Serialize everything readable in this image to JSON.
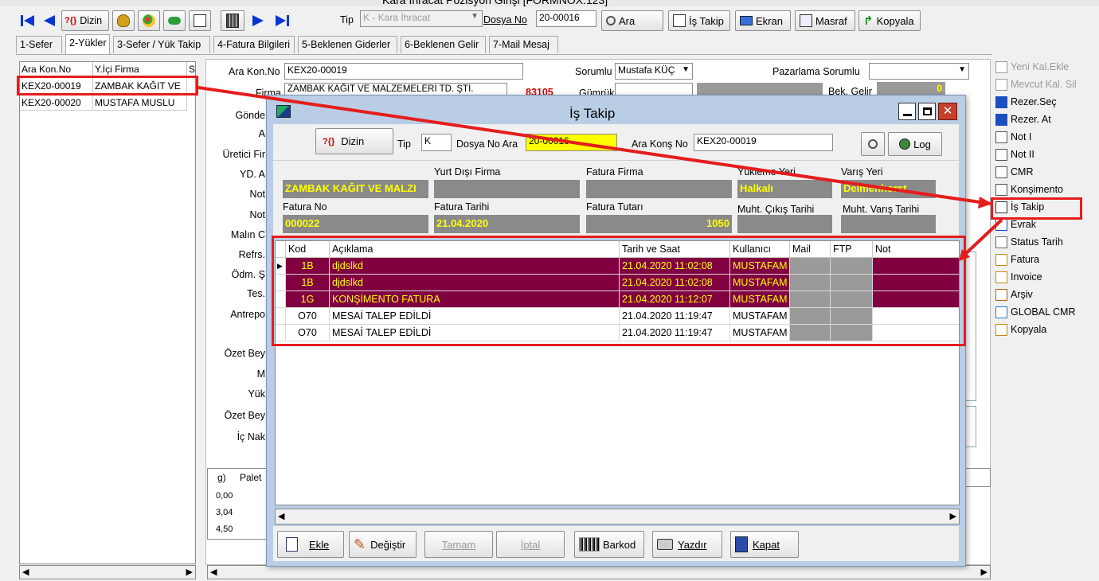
{
  "window": {
    "title": "Kara İhracat Pozisyon Girişi [FORMNOX:123]"
  },
  "toolbar": {
    "dizin": "Dizin",
    "tip_label": "Tip",
    "tip_value": "K - Kara İhracat",
    "dosya_label": "Dosya No",
    "dosya_value": "20-00016",
    "ara": "Ara",
    "is_takip": "İş Takip",
    "ekran": "Ekran",
    "masraf": "Masraf",
    "kopyala": "Kopyala"
  },
  "tabs": [
    "1-Sefer",
    "2-Yükler",
    "3-Sefer / Yük Takip",
    "4-Fatura Bilgileri",
    "5-Beklenen Giderler",
    "6-Beklenen Gelir",
    "7-Mail Mesaj"
  ],
  "left_list": {
    "headers": [
      "Ara Kon.No",
      "Y.İçi Firma",
      "S"
    ],
    "rows": [
      [
        "KEX20-00019",
        "ZAMBAK KAĞIT VE"
      ],
      [
        "KEX20-00020",
        "MUSTAFA MUSLU"
      ]
    ]
  },
  "form": {
    "ara_kon_label": "Ara Kon.No",
    "ara_kon_value": "KEX20-00019",
    "firma_label": "Firma",
    "firma_value": "ZAMBAK KAĞIT VE MALZEMELERİ TD. ŞTİ.",
    "firma_code": "83105",
    "sorumlu_label": "Sorumlu",
    "sorumlu_value": "Mustafa KÜÇ",
    "pazarlama_label": "Pazarlama Sorumlu",
    "gumruk_label": "Gümrük",
    "bek_gelir_label": "Bek. Gelir",
    "bek_gelir_value": "0",
    "side_labels": [
      "Gönde",
      "A",
      "Üretici Fir",
      "YD. A",
      "Not",
      "Not",
      "Malın C",
      "Refrs.",
      "Ödm. Ş",
      "Tes.",
      "Antrepo",
      "Özet Bey",
      "M",
      "Yük",
      "Özet Bey",
      "İç Nak"
    ],
    "bottom_header": [
      "g)",
      "Palet"
    ],
    "bottom_rows": [
      "0,00",
      "3,04",
      "4,50"
    ]
  },
  "right_menu": [
    {
      "label": "Yeni Kal.Ekle",
      "icon": "add-row-icon",
      "enabled": false
    },
    {
      "label": "Mevcut Kal. Sil",
      "icon": "delete-row-icon",
      "enabled": false
    },
    {
      "label": "Rezer.Seç",
      "icon": "rewind-icon",
      "enabled": true
    },
    {
      "label": "Rezer. At",
      "icon": "forward-icon",
      "enabled": true
    },
    {
      "label": "Not I",
      "icon": "note-icon",
      "enabled": true
    },
    {
      "label": "Not II",
      "icon": "note-icon",
      "enabled": true
    },
    {
      "label": "CMR",
      "icon": "document-icon",
      "enabled": true
    },
    {
      "label": "Konşimento",
      "icon": "document-icon",
      "enabled": true
    },
    {
      "label": "İş Takip",
      "icon": "checklist-icon",
      "enabled": true
    },
    {
      "label": "Evrak",
      "icon": "folder-icon",
      "enabled": true
    },
    {
      "label": "Status Tarih",
      "icon": "calendar-icon",
      "enabled": true
    },
    {
      "label": "Fatura",
      "icon": "invoice-icon",
      "enabled": true
    },
    {
      "label": "Invoice",
      "icon": "invoice-icon",
      "enabled": true
    },
    {
      "label": "Arşiv",
      "icon": "archive-icon",
      "enabled": true
    },
    {
      "label": "GLOBAL CMR",
      "icon": "globe-icon",
      "enabled": true
    },
    {
      "label": "Kopyala",
      "icon": "copy-icon",
      "enabled": true
    }
  ],
  "dialog": {
    "title": "İş Takip",
    "dizin": "Dizin",
    "tip_label": "Tip",
    "tip_value": "K",
    "dosya_label": "Dosya No Ara",
    "dosya_value": "20-00016",
    "ara_kons_label": "Ara Konş No",
    "ara_kons_value": "KEX20-00019",
    "log": "Log",
    "yurt_disi_label": "Yurt Dışı Firma",
    "fatura_firma_label": "Fatura Firma",
    "yukleme_label": "Yükleme Yeri",
    "varis_label": "Varış Yeri",
    "firma_value": "ZAMBAK KAĞIT VE MALZI",
    "yukleme_value": "Halkalı",
    "varis_value": "Delmenhorst",
    "fatura_no_label": "Fatura No",
    "fatura_tarih_label": "Fatura Tarihi",
    "fatura_tutar_label": "Fatura Tutarı",
    "muht_cikis_label": "Muht. Çıkış Tarihi",
    "muht_varis_label": "Muht. Varış Tarihi",
    "fatura_no_value": "000022",
    "fatura_tarih_value": "21.04.2020",
    "fatura_tutar_value": "1050",
    "table": {
      "headers": [
        "Kod",
        "Açıklama",
        "Tarih ve Saat",
        "Kullanıcı",
        "Mail",
        "FTP",
        "Not"
      ],
      "rows": [
        {
          "kod": "1B",
          "aciklama": "djdslkd",
          "tarih": "21.04.2020 11:02:08",
          "kullanici": "MUSTAFAM",
          "highlight": true,
          "current": true
        },
        {
          "kod": "1B",
          "aciklama": "djdslkd",
          "tarih": "21.04.2020 11:02:08",
          "kullanici": "MUSTAFAM",
          "highlight": true,
          "current": false
        },
        {
          "kod": "1G",
          "aciklama": "KONŞİMENTO FATURA",
          "tarih": "21.04.2020 11:12:07",
          "kullanici": "MUSTAFAM",
          "highlight": true,
          "current": false
        },
        {
          "kod": "O70",
          "aciklama": "MESAİ TALEP EDİLDİ",
          "tarih": "21.04.2020 11:19:47",
          "kullanici": "MUSTAFAM",
          "highlight": false,
          "current": false
        },
        {
          "kod": "O70",
          "aciklama": "MESAİ TALEP EDİLDİ",
          "tarih": "21.04.2020 11:19:47",
          "kullanici": "MUSTAFAM",
          "highlight": false,
          "current": false
        }
      ]
    },
    "buttons": {
      "ekle": "Ekle",
      "degistir": "Değiştir",
      "tamam": "Tamam",
      "iptal": "İptal",
      "barkod": "Barkod",
      "yazdir": "Yazdır",
      "kapat": "Kapat"
    }
  },
  "colors": {
    "highlight_row": "#800040",
    "highlight_text": "#ffff00",
    "dialog_border": "#b9cde5",
    "annotation": "#e61c1c"
  }
}
